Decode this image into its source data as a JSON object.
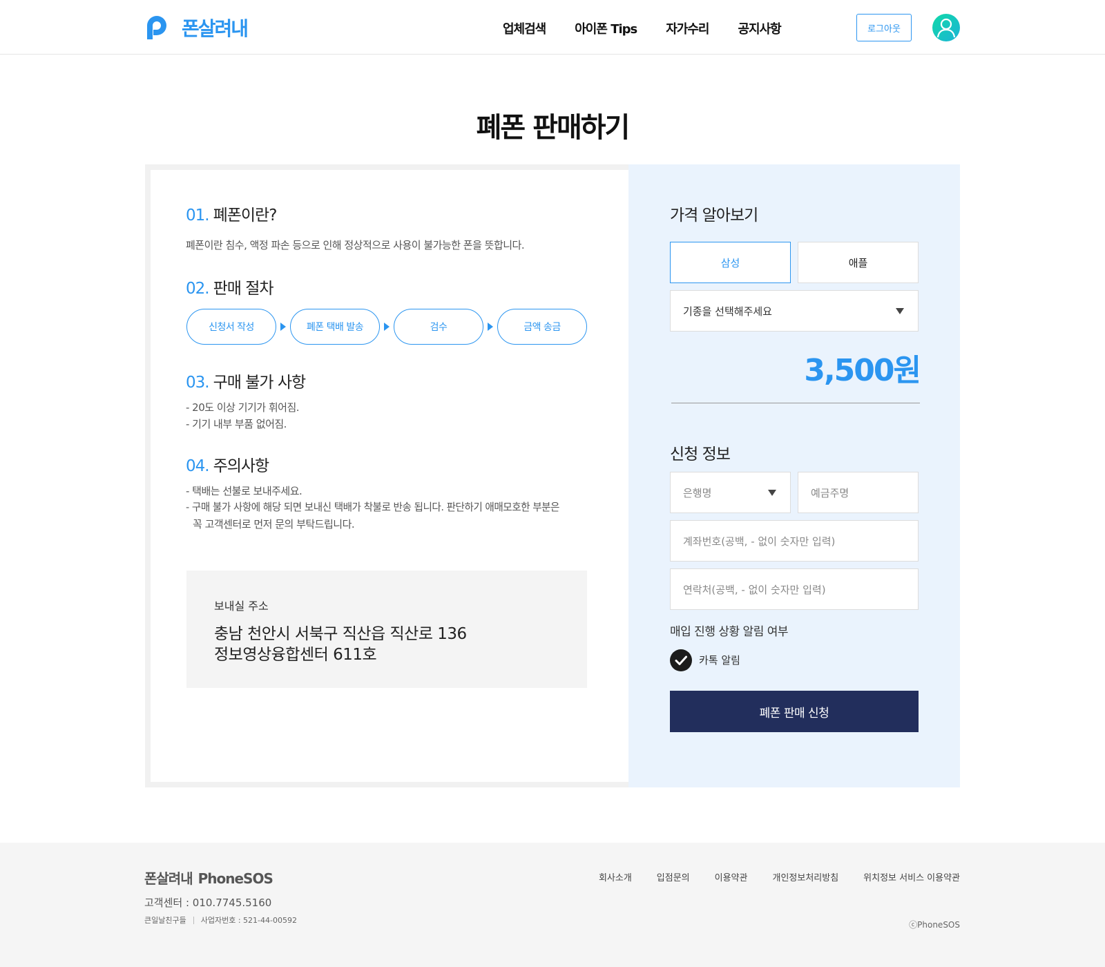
{
  "header": {
    "logo_text": "폰살려내",
    "nav": [
      "업체검색",
      "아이폰 Tips",
      "자가수리",
      "공지사항"
    ],
    "logout_label": "로그아웃"
  },
  "page_title": "폐폰 판매하기",
  "sections": {
    "s1": {
      "num": "01.",
      "title": "폐폰이란?",
      "body": "폐폰이란 침수, 액정 파손 등으로 인해 정상적으로 사용이 불가능한 폰을 뜻합니다."
    },
    "s2": {
      "num": "02.",
      "title": "판매 절차",
      "steps": [
        "신청서 작성",
        "폐폰 택배 발송",
        "검수",
        "금액 송금"
      ]
    },
    "s3": {
      "num": "03.",
      "title": "구매 불가 사항",
      "lines": [
        "- 20도 이상 기기가 휘어짐.",
        "- 기기 내부 부품 없어짐."
      ]
    },
    "s4": {
      "num": "04.",
      "title": "주의사항",
      "lines": [
        "- 택배는 선불로 보내주세요.",
        "- 구매 불가 사항에 해당 되면 보내신 택배가 착불로 반송 됩니다. 판단하기 애매모호한 부분은",
        "꼭 고객센터로 먼저 문의 부탁드립니다."
      ]
    }
  },
  "address": {
    "label": "보내실 주소",
    "line1": "충남 천안시 서북구 직산읍 직산로 136",
    "line2": "정보영상융합센터 611호"
  },
  "price_section": {
    "title": "가격 알아보기",
    "brands": [
      "삼성",
      "애플"
    ],
    "active_brand": "삼성",
    "model_placeholder": "기종을 선택해주세요",
    "price": "3,500원"
  },
  "apply_section": {
    "title": "신청 정보",
    "bank_placeholder": "은행명",
    "holder_placeholder": "예금주명",
    "account_placeholder": "계좌번호(공백, - 없이 숫자만 입력)",
    "phone_placeholder": "연락처(공백, - 없이 숫자만 입력)",
    "notify_label": "매입 진행 상황 알림 여부",
    "kakao_label": "카톡 알림",
    "kakao_checked": true,
    "submit_label": "폐폰 판매 신청"
  },
  "footer": {
    "logo_ko": "폰살려내",
    "logo_en": "PhoneSOS",
    "cs": "고객센터 : 010.7745.5160",
    "company": "큰일날친구들",
    "biz_no": "사업자번호 : 521-44-00592",
    "links": [
      "회사소개",
      "입점문의",
      "이용약관",
      "개인정보처리방침",
      "위치정보 서비스 이용약관"
    ],
    "copyright": "ⓒPhoneSOS"
  },
  "colors": {
    "accent": "#2b95f0",
    "submit_bg": "#222e5c",
    "right_bg": "#eaf3fd"
  }
}
